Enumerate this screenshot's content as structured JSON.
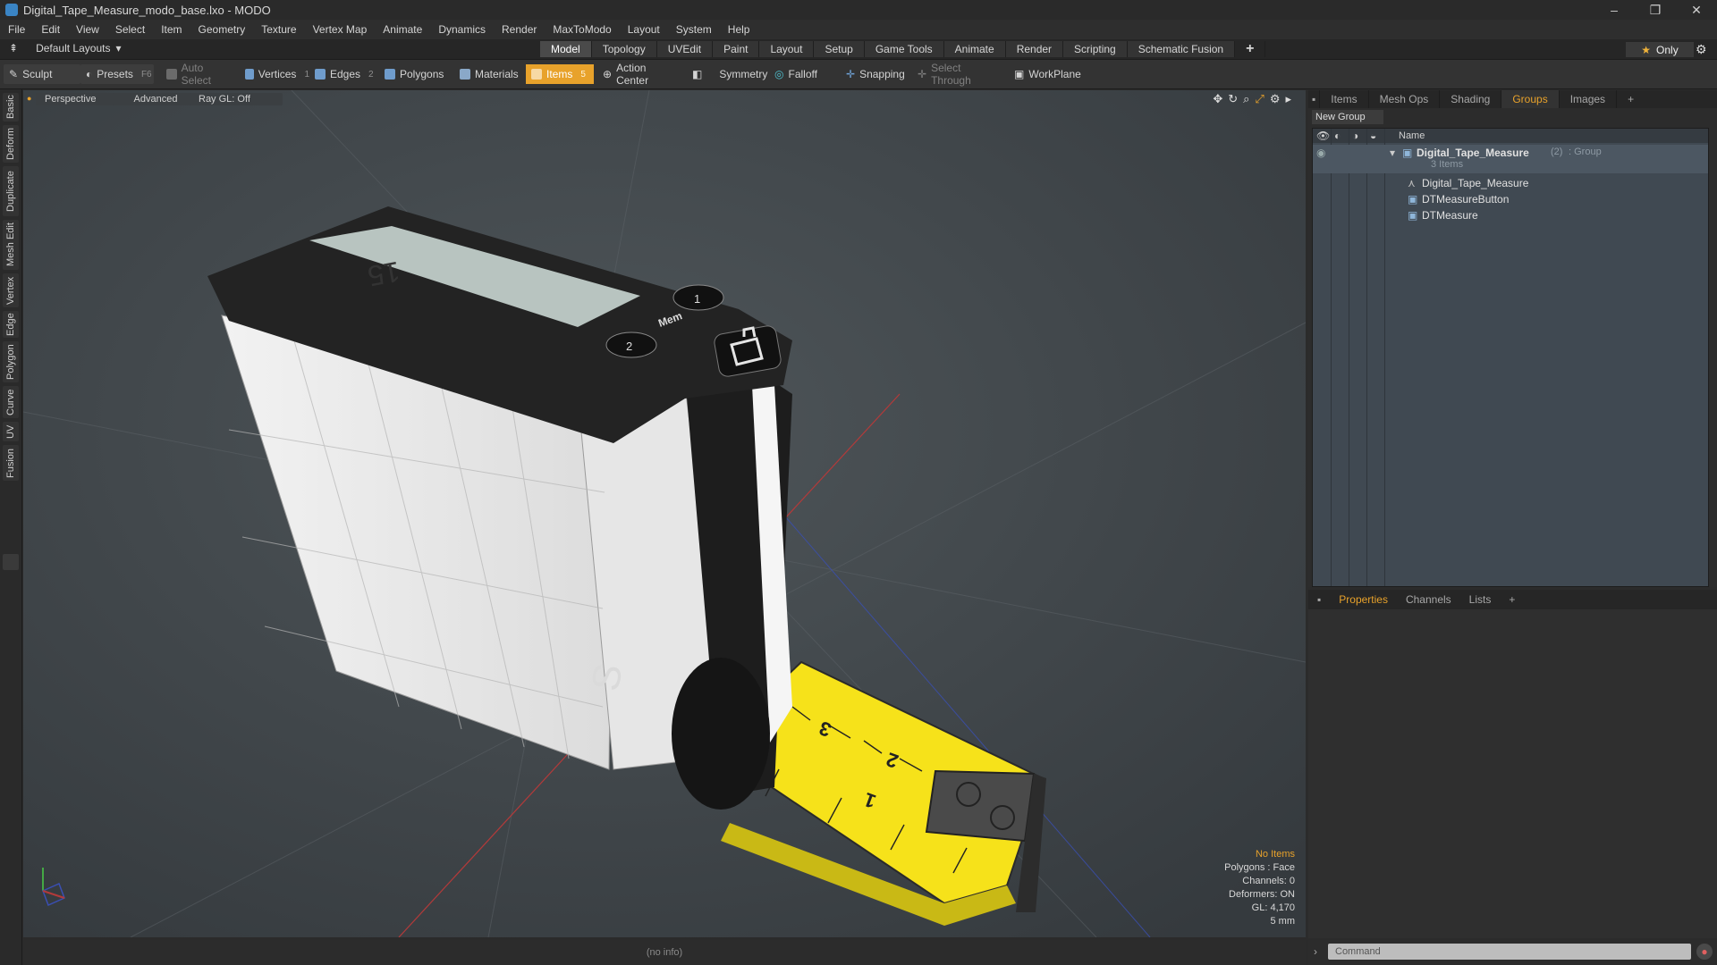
{
  "window": {
    "title": "Digital_Tape_Measure_modo_base.lxo - MODO",
    "minimize": "–",
    "restore": "❐",
    "close": "✕"
  },
  "menu": [
    "File",
    "Edit",
    "View",
    "Select",
    "Item",
    "Geometry",
    "Texture",
    "Vertex Map",
    "Animate",
    "Dynamics",
    "Render",
    "MaxToModo",
    "Layout",
    "System",
    "Help"
  ],
  "layout_bar": {
    "layouts_label": "Default Layouts",
    "tabs": [
      "Model",
      "Topology",
      "UVEdit",
      "Paint",
      "Layout",
      "Setup",
      "Game Tools",
      "Animate",
      "Render",
      "Scripting",
      "Schematic Fusion"
    ],
    "active_tab": "Model",
    "plus": "+",
    "only_label": "Only"
  },
  "toolbar": {
    "sculpt": "Sculpt",
    "presets": "Presets",
    "presets_key": "F6",
    "auto_select": "Auto Select",
    "vertices": "Vertices",
    "vertices_key": "1",
    "edges": "Edges",
    "edges_key": "2",
    "polygons": "Polygons",
    "materials": "Materials",
    "items": "Items",
    "items_key": "5",
    "action_center": "Action Center",
    "symmetry": "Symmetry",
    "falloff": "Falloff",
    "snapping": "Snapping",
    "select_through": "Select Through",
    "workplane": "WorkPlane"
  },
  "left_tabs": [
    "Basic",
    "Deform",
    "Duplicate",
    "Mesh Edit",
    "Vertex",
    "Edge",
    "Polygon",
    "Curve",
    "UV",
    "Fusion"
  ],
  "viewport": {
    "view_mode": "Perspective",
    "shading": "Advanced",
    "raygl": "Ray GL: Off",
    "hud": {
      "selection": "No Items",
      "polygons": "Polygons : Face",
      "channels": "Channels: 0",
      "deformers": "Deformers: ON",
      "gl": "GL: 4,170",
      "grid": "5 mm"
    },
    "status": "(no info)",
    "lcd_digits": "15",
    "mem_label": "Mem",
    "btn1": "1",
    "btn2": "2",
    "tape_numbers": [
      "1",
      "2",
      "3"
    ]
  },
  "right_panel": {
    "tabs": [
      "Items",
      "Mesh Ops",
      "Shading",
      "Groups",
      "Images"
    ],
    "active_tab": "Groups",
    "new_group": "New Group",
    "column_name": "Name",
    "group": {
      "name": "Digital_Tape_Measure",
      "count": "(2)",
      "type": ": Group",
      "items_count": "3 Items"
    },
    "children": [
      "Digital_Tape_Measure",
      "DTMeasureButton",
      "DTMeasure"
    ]
  },
  "props_panel": {
    "tabs": [
      "Properties",
      "Channels",
      "Lists"
    ],
    "active_tab": "Properties"
  },
  "command": {
    "placeholder": "Command"
  },
  "colors": {
    "accent": "#e8a22b",
    "viewport_bg": "#454b4f",
    "tape_yellow": "#f6e21a"
  }
}
